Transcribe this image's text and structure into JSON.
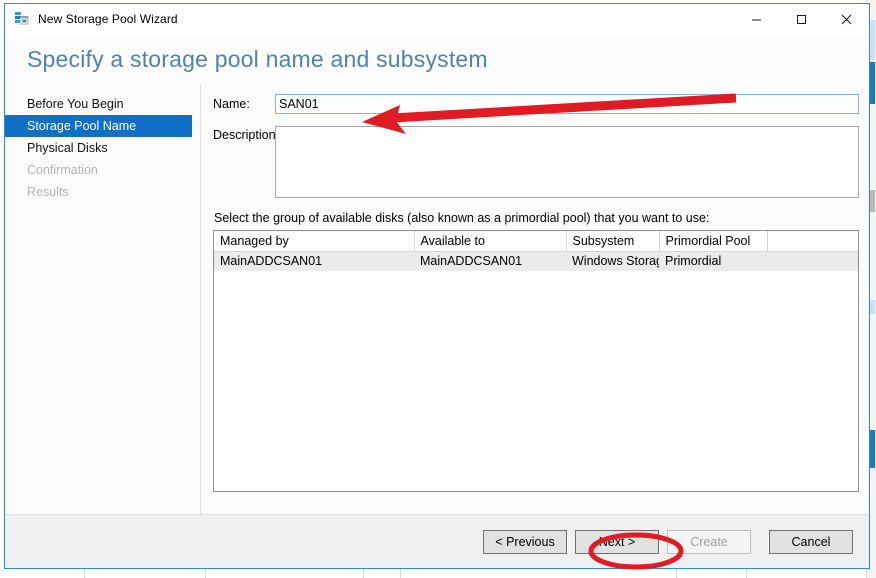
{
  "window": {
    "title": "New Storage Pool Wizard",
    "icon": "storage-pool-icon",
    "controls": {
      "minimize": "—",
      "maximize": "☐",
      "close": "✕"
    }
  },
  "header": {
    "page_title": "Specify a storage pool name and subsystem"
  },
  "sidebar": {
    "items": [
      {
        "label": "Before You Begin",
        "state": "enabled"
      },
      {
        "label": "Storage Pool Name",
        "state": "active"
      },
      {
        "label": "Physical Disks",
        "state": "enabled"
      },
      {
        "label": "Confirmation",
        "state": "disabled"
      },
      {
        "label": "Results",
        "state": "disabled"
      }
    ]
  },
  "form": {
    "name_label": "Name:",
    "name_value": "SAN01",
    "name_placeholder": "",
    "description_label": "Description:",
    "description_value": "",
    "description_placeholder": ""
  },
  "list": {
    "instruction": "Select the group of available disks (also known as a primordial pool) that you want to use:",
    "columns": [
      "Managed by",
      "Available to",
      "Subsystem",
      "Primordial Pool",
      ""
    ],
    "rows": [
      {
        "managed_by": "MainADDCSAN01",
        "available_to": "MainADDCSAN01",
        "subsystem": "Windows Storage",
        "primordial_pool": "Primordial",
        "spacer": "",
        "selected": true
      }
    ]
  },
  "footer": {
    "previous_label": "< Previous",
    "next_label": "Next >",
    "create_label": "Create",
    "cancel_label": "Cancel",
    "create_disabled": true
  },
  "annotations": {
    "arrow": {
      "name": "red-arrow-annotation",
      "color": "#e01b24",
      "points_to": "name-input"
    },
    "ellipse": {
      "name": "red-ellipse-annotation",
      "color": "#e01b24",
      "encircles": "next-button"
    }
  },
  "colors": {
    "accent": "#0f70c6",
    "title_blue": "#4f82ad",
    "border_blue": "#2a8ad4",
    "annotation_red": "#e01b24"
  }
}
